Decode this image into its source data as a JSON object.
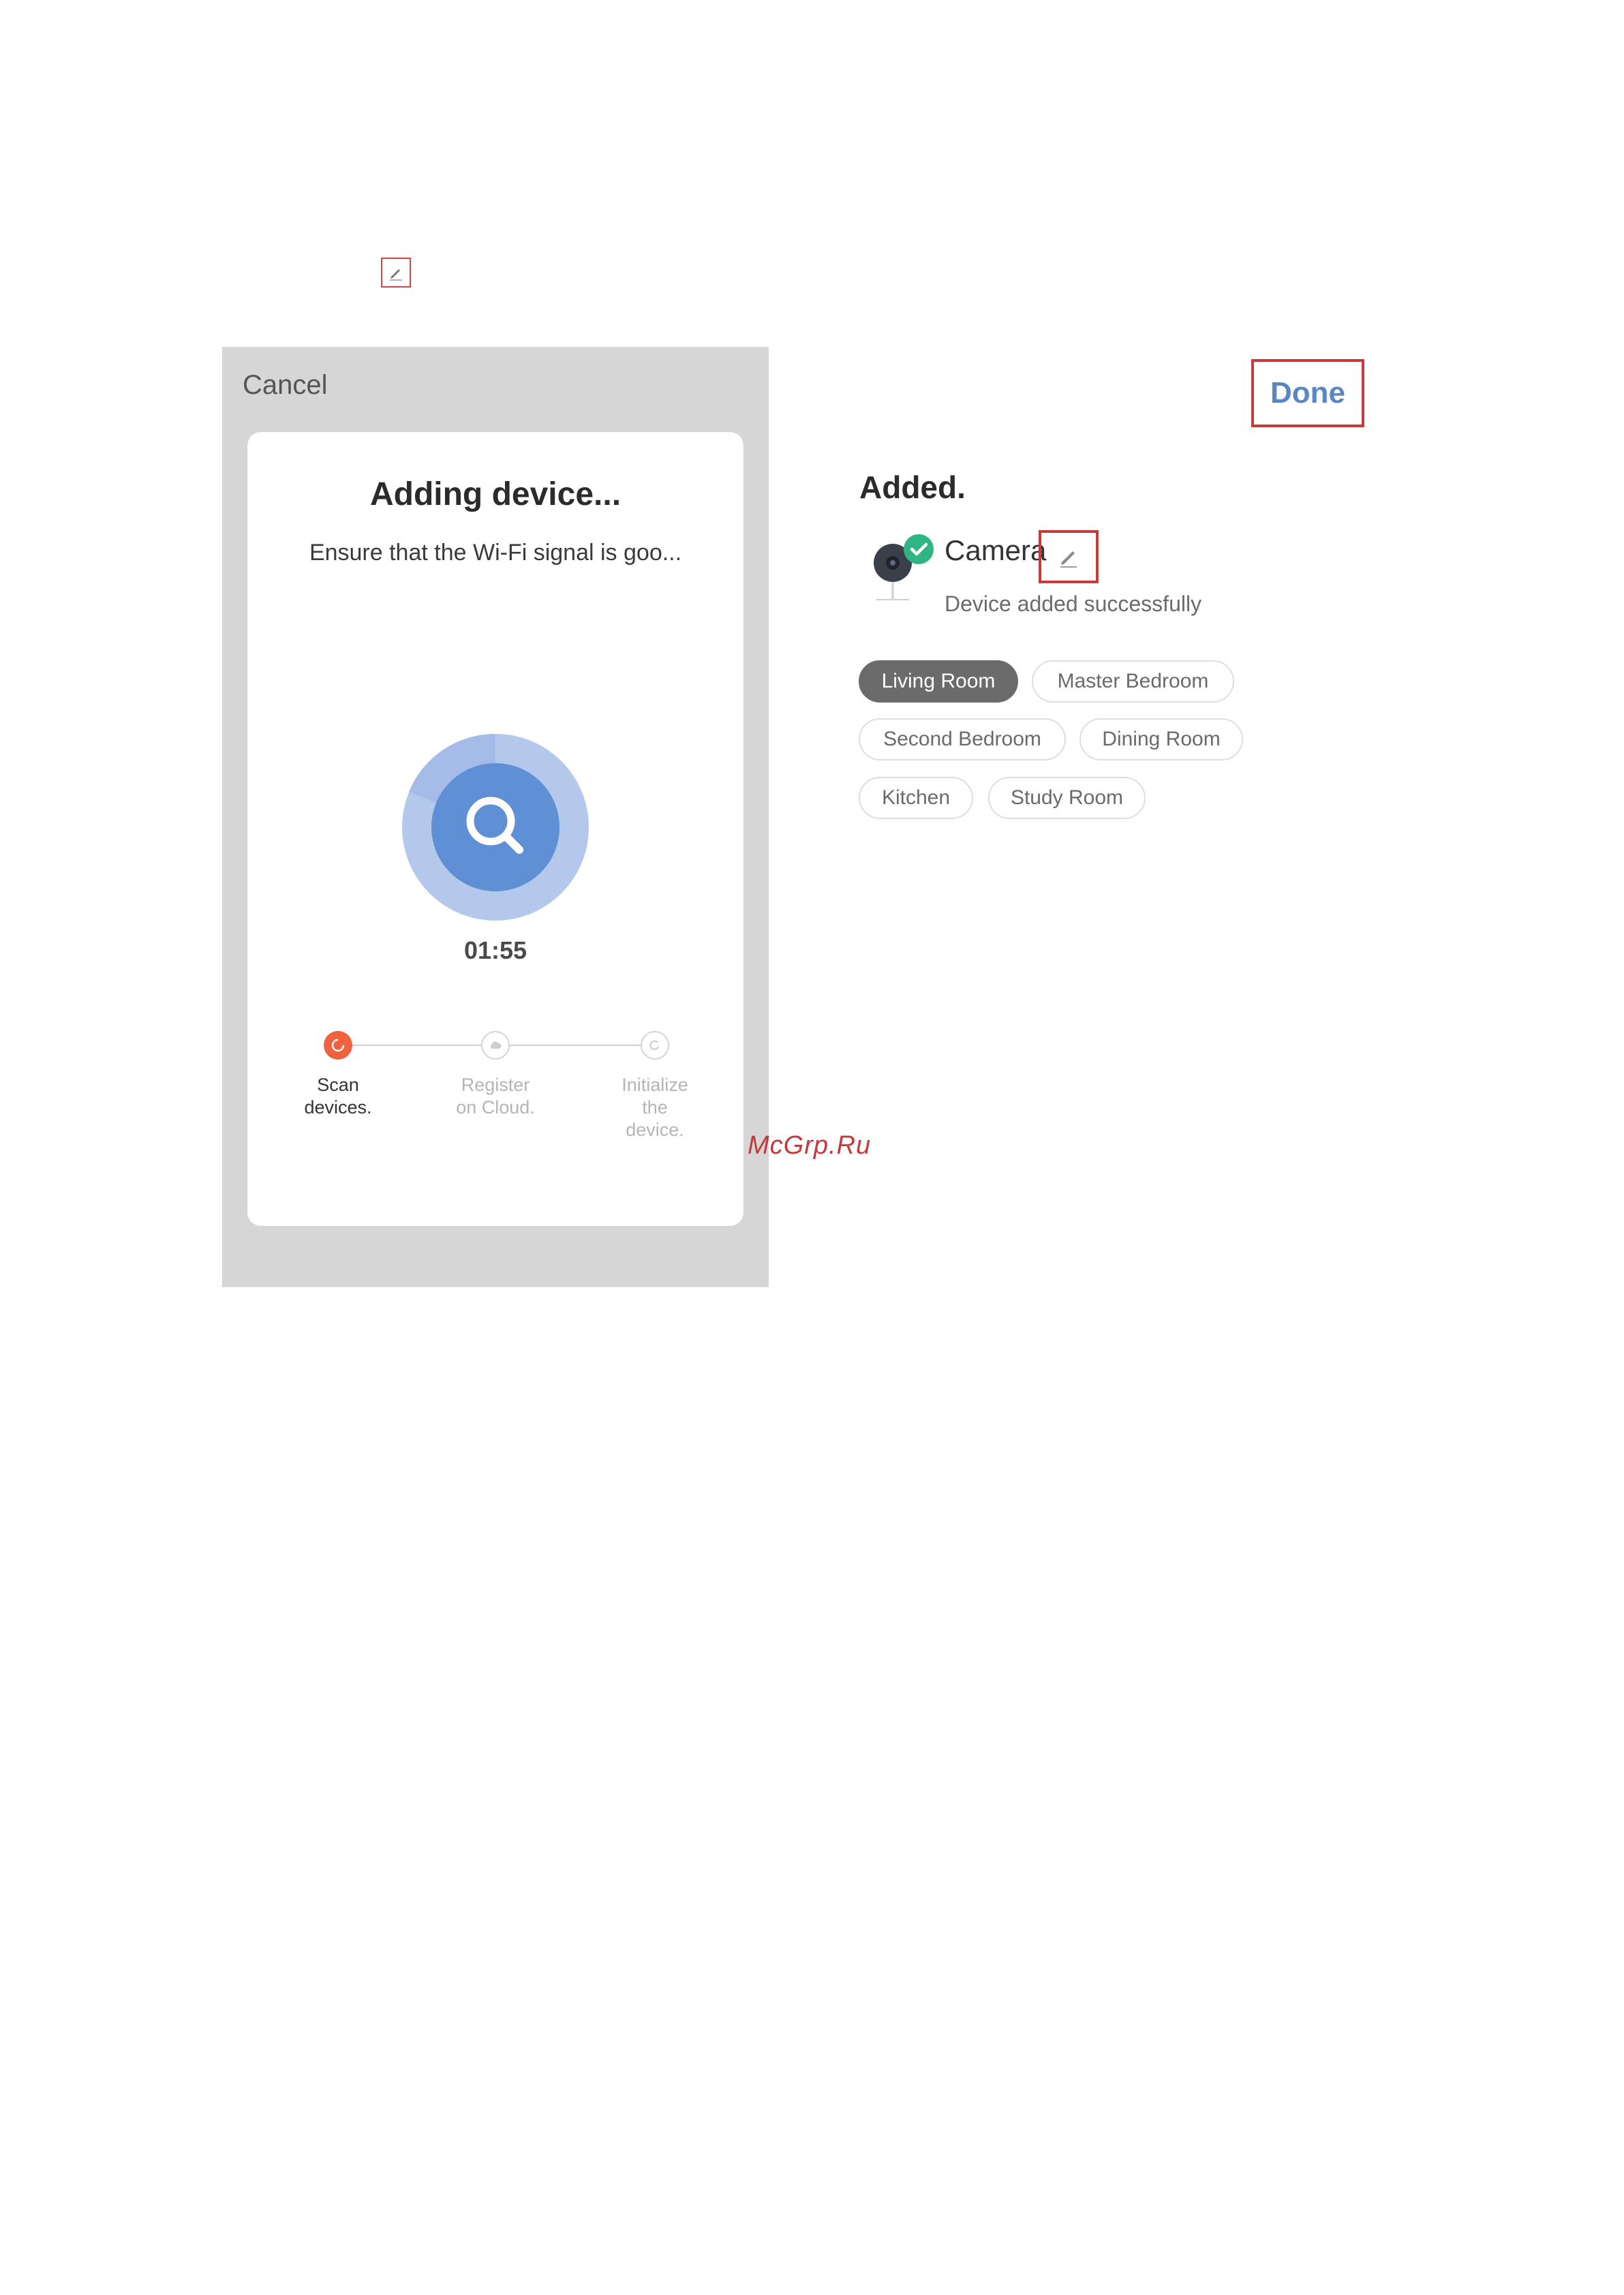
{
  "left_screen": {
    "cancel_label": "Cancel",
    "title": "Adding device...",
    "subtitle": "Ensure that the Wi-Fi signal is goo...",
    "timer": "01:55",
    "steps": [
      {
        "label_line1": "Scan",
        "label_line2": "devices.",
        "label_line3": "",
        "state": "active"
      },
      {
        "label_line1": "Register",
        "label_line2": "on Cloud.",
        "label_line3": "",
        "state": "pending"
      },
      {
        "label_line1": "Initialize",
        "label_line2": "the",
        "label_line3": "device.",
        "state": "pending"
      }
    ],
    "colors": {
      "active_step": "#f0613e",
      "scanner_inner": "#5f8fd4",
      "scanner_outer": "#b4c8ec"
    }
  },
  "right_screen": {
    "done_label": "Done",
    "added_title": "Added.",
    "device": {
      "name": "Camera",
      "status": "Device added successfully",
      "icon": "camera-icon",
      "badge_icon": "check-icon"
    },
    "rooms": [
      {
        "label": "Living Room",
        "selected": true
      },
      {
        "label": "Master Bedroom",
        "selected": false
      },
      {
        "label": "Second Bedroom",
        "selected": false
      },
      {
        "label": "Dining Room",
        "selected": false
      },
      {
        "label": "Kitchen",
        "selected": false
      },
      {
        "label": "Study Room",
        "selected": false
      }
    ],
    "colors": {
      "done": "#5b86c4",
      "highlight_box": "#c83a3a",
      "success_badge": "#2fb584"
    }
  },
  "watermark": "McGrp.Ru"
}
